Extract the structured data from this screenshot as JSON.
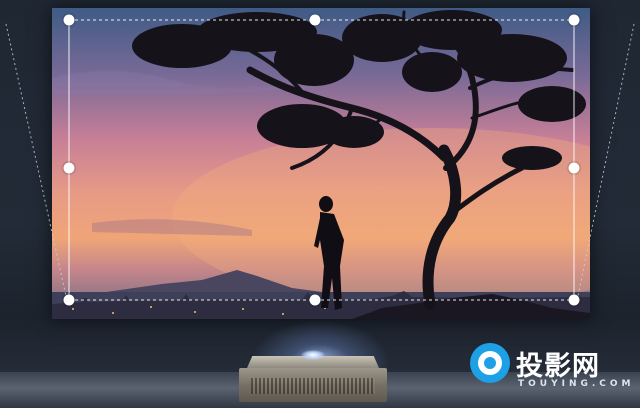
{
  "logo": {
    "name": "投影网",
    "subtitle": "TOUYING.COM",
    "accent": "#1ea0e6"
  },
  "colors": {
    "background": "#222b37",
    "handle": "#ffffff",
    "frame_line": "#ffffff"
  },
  "controls": {
    "handles": [
      "corner-top-left",
      "edge-top",
      "corner-top-right",
      "edge-left",
      "edge-right",
      "corner-bottom-left",
      "edge-bottom",
      "corner-bottom-right"
    ]
  }
}
